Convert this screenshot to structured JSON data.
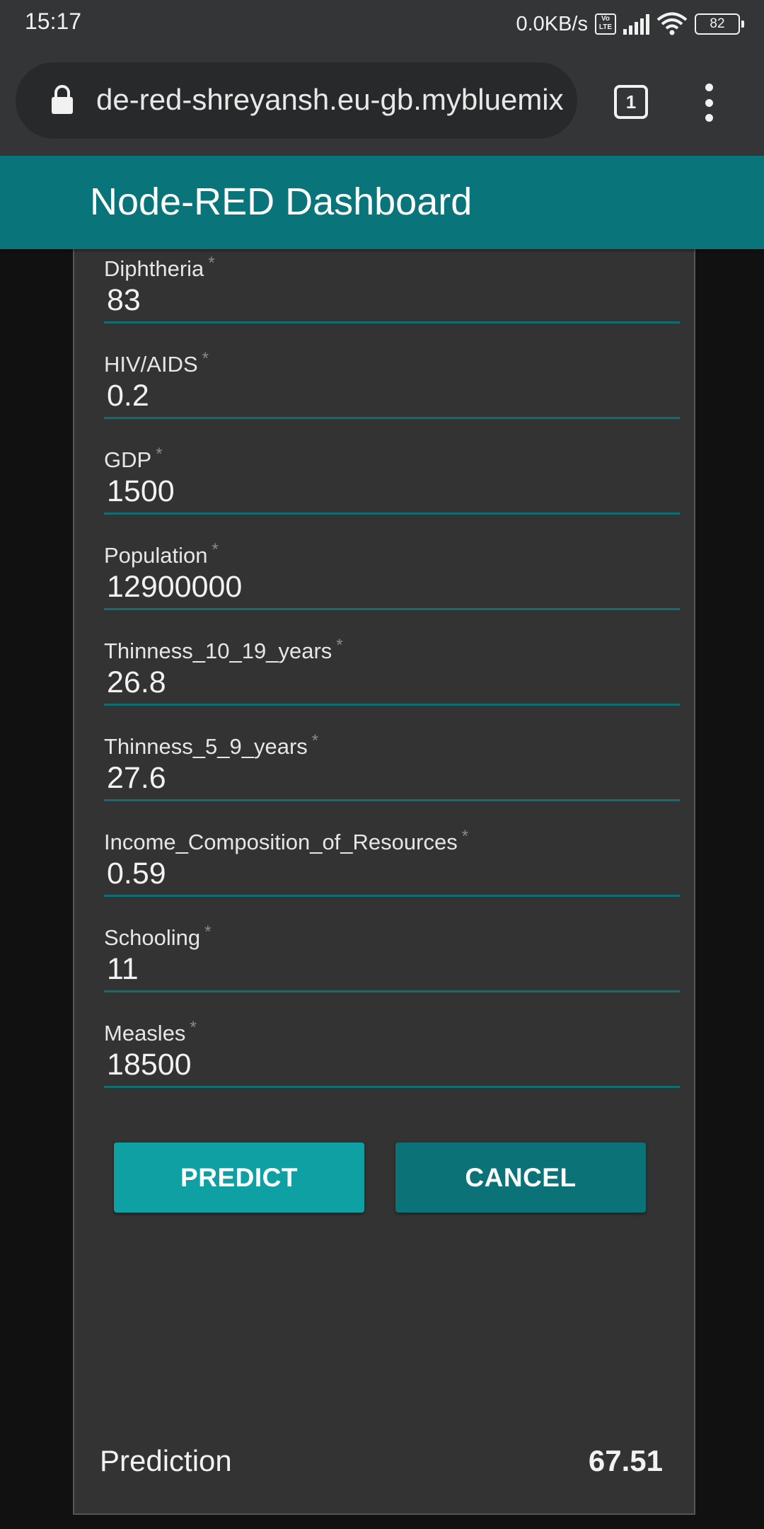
{
  "status_bar": {
    "time": "15:17",
    "net_speed": "0.0KB/s",
    "volte_top": "Vo",
    "volte_bottom": "LTE",
    "battery": "82"
  },
  "browser": {
    "url": "de-red-shreyansh.eu-gb.mybluemix",
    "tab_count": "1"
  },
  "dashboard": {
    "title": "Node-RED Dashboard"
  },
  "form": {
    "required_mark": "*",
    "fields": [
      {
        "label": "Diphtheria",
        "value": "83"
      },
      {
        "label": "HIV/AIDS",
        "value": "0.2"
      },
      {
        "label": "GDP",
        "value": "1500"
      },
      {
        "label": "Population",
        "value": "12900000"
      },
      {
        "label": "Thinness_10_19_years",
        "value": "26.8"
      },
      {
        "label": "Thinness_5_9_years",
        "value": "27.6"
      },
      {
        "label": "Income_Composition_of_Resources",
        "value": "0.59"
      },
      {
        "label": "Schooling",
        "value": "11"
      },
      {
        "label": "Measles",
        "value": "18500"
      }
    ],
    "predict_label": "PREDICT",
    "cancel_label": "CANCEL"
  },
  "prediction": {
    "label": "Prediction",
    "value": "67.51"
  },
  "colors": {
    "accent": "#097479",
    "button_primary": "#0fa0a4",
    "button_secondary": "#0b7378",
    "card_bg": "#333333",
    "page_bg": "#111111"
  }
}
